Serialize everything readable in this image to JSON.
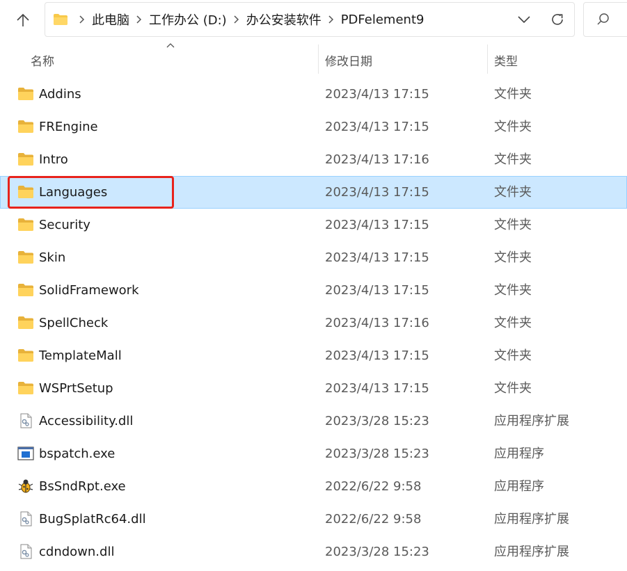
{
  "address_bar": {
    "breadcrumbs": [
      "此电脑",
      "工作办公 (D:)",
      "办公安装软件",
      "PDFelement9"
    ]
  },
  "columns": {
    "name": "名称",
    "date": "修改日期",
    "type": "类型"
  },
  "files": [
    {
      "name": "Addins",
      "date": "2023/4/13 17:15",
      "type": "文件夹",
      "icon": "folder-icon"
    },
    {
      "name": "FREngine",
      "date": "2023/4/13 17:15",
      "type": "文件夹",
      "icon": "folder-icon"
    },
    {
      "name": "Intro",
      "date": "2023/4/13 17:16",
      "type": "文件夹",
      "icon": "folder-icon"
    },
    {
      "name": "Languages",
      "date": "2023/4/13 17:15",
      "type": "文件夹",
      "icon": "folder-icon",
      "selected": true
    },
    {
      "name": "Security",
      "date": "2023/4/13 17:15",
      "type": "文件夹",
      "icon": "folder-icon"
    },
    {
      "name": "Skin",
      "date": "2023/4/13 17:15",
      "type": "文件夹",
      "icon": "folder-icon"
    },
    {
      "name": "SolidFramework",
      "date": "2023/4/13 17:15",
      "type": "文件夹",
      "icon": "folder-icon"
    },
    {
      "name": "SpellCheck",
      "date": "2023/4/13 17:16",
      "type": "文件夹",
      "icon": "folder-icon"
    },
    {
      "name": "TemplateMall",
      "date": "2023/4/13 17:15",
      "type": "文件夹",
      "icon": "folder-icon"
    },
    {
      "name": "WSPrtSetup",
      "date": "2023/4/13 17:15",
      "type": "文件夹",
      "icon": "folder-icon"
    },
    {
      "name": "Accessibility.dll",
      "date": "2023/3/28 15:23",
      "type": "应用程序扩展",
      "icon": "dll-file-icon"
    },
    {
      "name": "bspatch.exe",
      "date": "2023/3/28 15:23",
      "type": "应用程序",
      "icon": "exe-window-icon"
    },
    {
      "name": "BsSndRpt.exe",
      "date": "2022/6/22 9:58",
      "type": "应用程序",
      "icon": "bug-app-icon"
    },
    {
      "name": "BugSplatRc64.dll",
      "date": "2022/6/22 9:58",
      "type": "应用程序扩展",
      "icon": "dll-file-icon"
    },
    {
      "name": "cdndown.dll",
      "date": "2023/3/28 15:23",
      "type": "应用程序扩展",
      "icon": "dll-file-icon"
    }
  ],
  "colors": {
    "selection_bg": "#cce8ff",
    "annotation_red": "#e8231c",
    "folder_yellow": "#f8c94a"
  }
}
